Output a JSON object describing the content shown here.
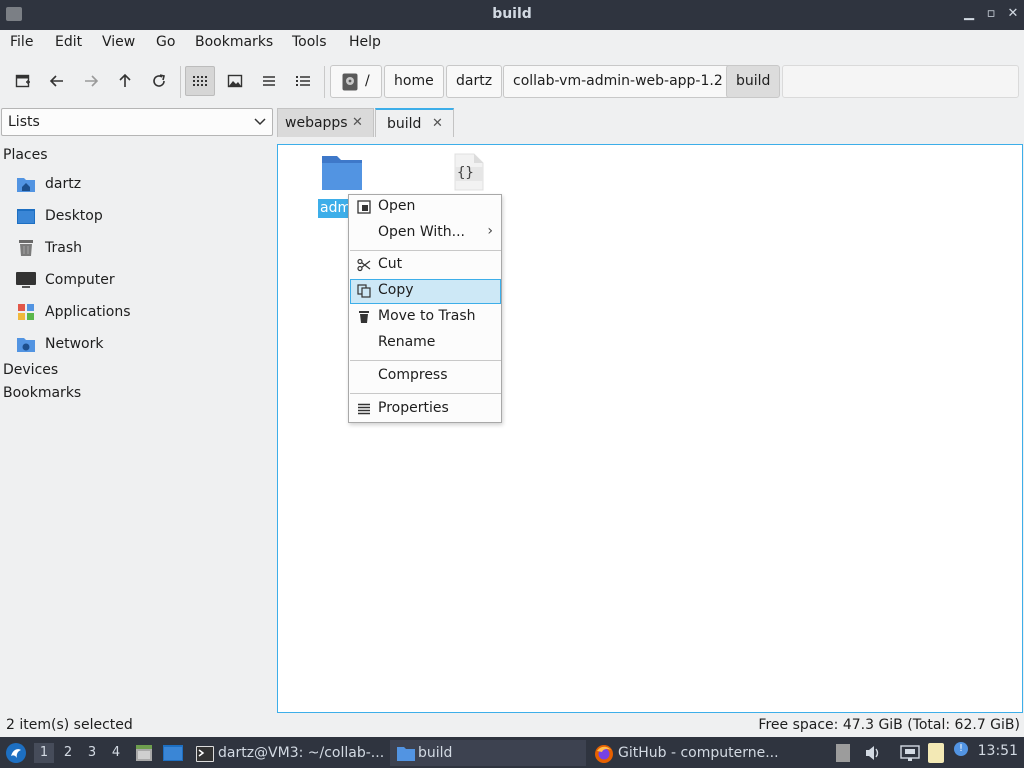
{
  "window": {
    "title": "build"
  },
  "menubar": {
    "items": [
      "File",
      "Edit",
      "View",
      "Go",
      "Bookmarks",
      "Tools",
      "Help"
    ]
  },
  "toolbar": {
    "buttons": [
      "new-window-icon",
      "back-icon",
      "forward-icon",
      "up-icon",
      "reload-icon",
      "icon-view-icon",
      "thumbnail-view-icon",
      "compact-view-icon",
      "detailed-view-icon"
    ],
    "active_view": "icon-view-icon"
  },
  "breadcrumb": {
    "root": "/",
    "segments": [
      "home",
      "dartz",
      "collab-vm-admin-web-app-1.2",
      "build"
    ]
  },
  "side_pane": {
    "mode_select": "Lists",
    "places_header": "Places",
    "places": [
      "dartz",
      "Desktop",
      "Trash",
      "Computer",
      "Applications",
      "Network"
    ],
    "devices_header": "Devices",
    "bookmarks_header": "Bookmarks"
  },
  "tabs": [
    {
      "label": "webapps",
      "close": "✕"
    },
    {
      "label": "build",
      "close": "✕"
    }
  ],
  "files": [
    {
      "label": "adm",
      "type": "folder",
      "selected": true
    },
    {
      "label": "",
      "type": "json-file",
      "icon_text": "{}"
    }
  ],
  "context_menu": {
    "items": [
      {
        "label": "Open",
        "icon": "open-icon"
      },
      {
        "label": "Open With...",
        "submenu": "›"
      },
      {
        "label": "Cut",
        "icon": "scissors-icon"
      },
      {
        "label": "Copy",
        "icon": "copy-icon",
        "highlighted": true
      },
      {
        "label": "Move to Trash",
        "icon": "trash-icon"
      },
      {
        "label": "Rename"
      },
      {
        "label": "Compress"
      },
      {
        "label": "Properties",
        "icon": "properties-icon"
      }
    ]
  },
  "statusbar": {
    "selection": "2 item(s) selected",
    "free_space": "Free space: 47.3 GiB (Total: 62.7 GiB)"
  },
  "taskbar": {
    "workspaces": [
      "1",
      "2",
      "3",
      "4"
    ],
    "active_workspace": "1",
    "tasks": [
      {
        "label": "dartz@VM3: ~/collab-...",
        "icon": "terminal-icon"
      },
      {
        "label": "build",
        "icon": "folder-icon",
        "active": true
      },
      {
        "label": "GitHub - computerne...",
        "icon": "firefox-icon"
      }
    ],
    "clock": "13:51"
  },
  "colors": {
    "accent": "#3daee9",
    "titlebar": "#2f343f",
    "folder": "#5294e2",
    "menu_highlight": "#cde8f6"
  }
}
